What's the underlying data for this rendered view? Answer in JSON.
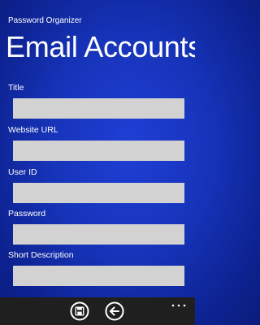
{
  "app": {
    "name": "Password Organizer",
    "page_title": "Email Accounts"
  },
  "form": {
    "fields": [
      {
        "label": "Title",
        "value": "",
        "placeholder": ""
      },
      {
        "label": "Website URL",
        "value": "",
        "placeholder": ""
      },
      {
        "label": "User ID",
        "value": "",
        "placeholder": ""
      },
      {
        "label": "Password",
        "value": "",
        "placeholder": ""
      },
      {
        "label": "Short Description",
        "value": "",
        "placeholder": ""
      }
    ]
  },
  "app_bar": {
    "buttons": [
      {
        "icon": "save-icon"
      },
      {
        "icon": "back-arrow-icon"
      }
    ],
    "more_icon": "ellipsis-icon",
    "background": "#1f1f1f"
  },
  "colors": {
    "accent_background": "#1633b8",
    "input_background": "#d2d2d2",
    "text": "#ffffff"
  }
}
